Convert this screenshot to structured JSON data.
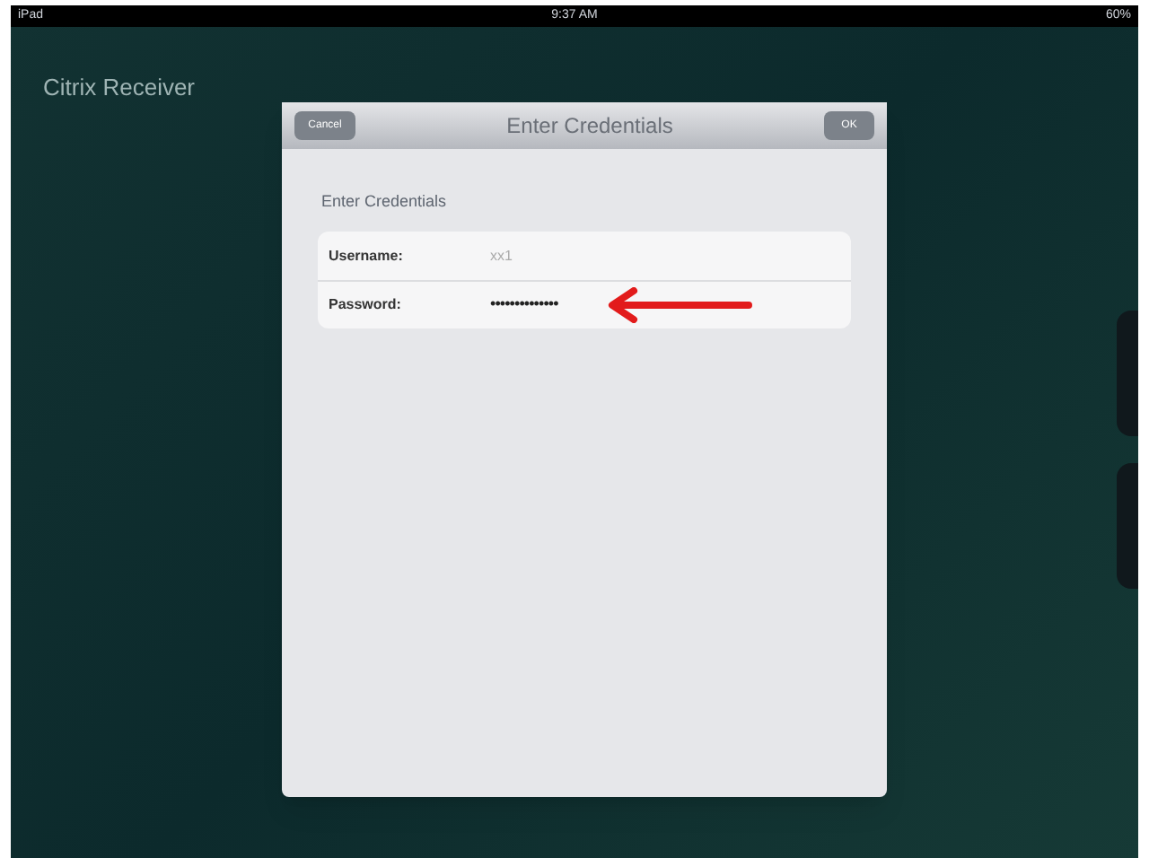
{
  "status_bar": {
    "device": "iPad",
    "time": "9:37 AM",
    "battery": "60%"
  },
  "app": {
    "title": "Citrix Receiver"
  },
  "dialog": {
    "title": "Enter Credentials",
    "cancel_button": "Cancel",
    "ok_button": "OK",
    "section_label": "Enter Credentials",
    "fields": [
      {
        "label": "Username:",
        "value": "xx1",
        "kind": "text"
      },
      {
        "label": "Password:",
        "value": "••••••••••••••",
        "kind": "password"
      }
    ]
  }
}
